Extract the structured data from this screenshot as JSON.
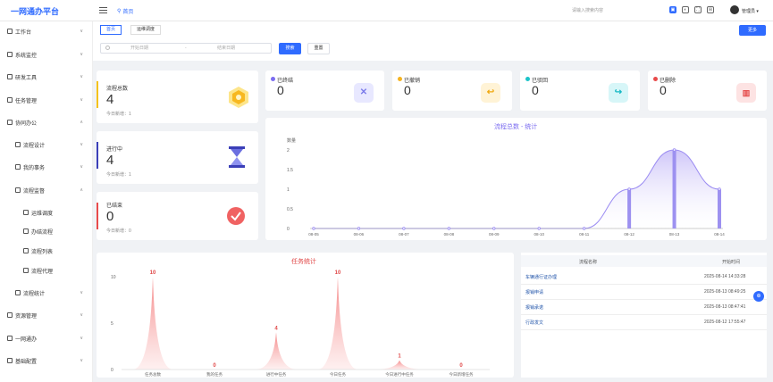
{
  "header": {
    "logo": "一网通办平台",
    "home_tab": "首页",
    "search_placeholder": "请输入搜索内容",
    "user": "管理员"
  },
  "sidebar": {
    "items": [
      {
        "label": "工作台",
        "icon": "monitor-icon"
      },
      {
        "label": "系统监控",
        "icon": "monitor-icon"
      },
      {
        "label": "研发工具",
        "icon": "tools-icon"
      },
      {
        "label": "任务管理",
        "icon": "task-icon"
      },
      {
        "label": "协同办公",
        "icon": "cooperate-icon"
      },
      {
        "label": "流程设计",
        "icon": "design-icon"
      },
      {
        "label": "我的事务",
        "icon": "bell-icon"
      },
      {
        "label": "流程监督",
        "icon": "house-icon"
      },
      {
        "label": "运维调度",
        "icon": "dispatch-icon"
      },
      {
        "label": "办结流程",
        "icon": "link-icon"
      },
      {
        "label": "流程列表",
        "icon": "list-icon"
      },
      {
        "label": "流程代理",
        "icon": "proxy-icon"
      },
      {
        "label": "流程统计",
        "icon": "stats-icon"
      },
      {
        "label": "资源管理",
        "icon": "resource-icon"
      },
      {
        "label": "一网通办",
        "icon": "network-icon"
      },
      {
        "label": "基础配置",
        "icon": "config-icon"
      }
    ]
  },
  "tabs": [
    "首页",
    "运维调度"
  ],
  "more_button": "更多",
  "filter": {
    "start_placeholder": "开始日期",
    "separator": "-",
    "end_placeholder": "结束日期",
    "search": "搜索",
    "reset": "重置"
  },
  "big_cards": [
    {
      "title": "流程总数",
      "value": "4",
      "sub": "今日新增：1",
      "color": "#f5c21a"
    },
    {
      "title": "进行中",
      "value": "4",
      "sub": "今日新增：1",
      "color": "#3b3fb8"
    },
    {
      "title": "已结束",
      "value": "0",
      "sub": "今日新增：0",
      "color": "#e84a4a"
    }
  ],
  "small_cards": [
    {
      "title": "已终结",
      "value": "0",
      "dot": "#7b6cf0",
      "icon_bg": "#e8e8ff",
      "icon_color": "#7b7bea",
      "glyph": "✕"
    },
    {
      "title": "已撤销",
      "value": "0",
      "dot": "#f5b320",
      "icon_bg": "#fff3d6",
      "icon_color": "#f0a810",
      "glyph": "↩"
    },
    {
      "title": "已驳回",
      "value": "0",
      "dot": "#1cc3c9",
      "icon_bg": "#d7f6f8",
      "icon_color": "#14b8c4",
      "glyph": "↪"
    },
    {
      "title": "已删除",
      "value": "0",
      "dot": "#e84a4a",
      "icon_bg": "#fde3e3",
      "icon_color": "#e54848",
      "glyph": "🗑"
    }
  ],
  "chart_data": [
    {
      "type": "area",
      "title": "流程总数 - 统计",
      "ylabel": "数量",
      "categories": [
        "08-05",
        "08-06",
        "08-07",
        "08-08",
        "08-09",
        "08-10",
        "08-11",
        "08-12",
        "08-13",
        "08-14"
      ],
      "values": [
        0,
        0,
        0,
        0,
        0,
        0,
        0,
        1,
        2,
        1
      ],
      "ylim": [
        0,
        2
      ],
      "yticks": [
        "0",
        "0.5",
        "1",
        "1.5",
        "2"
      ],
      "color": "#9b8cf2"
    },
    {
      "type": "area",
      "title": "任务统计",
      "categories": [
        "任务总数",
        "我的任务",
        "进行中任务",
        "今日任务",
        "今日进行中任务",
        "今日新增任务"
      ],
      "values": [
        10,
        0,
        4,
        10,
        1,
        0
      ],
      "ylim": [
        0,
        10
      ],
      "yticks": [
        "0",
        "5",
        "10"
      ],
      "color": "#f08a8a"
    }
  ],
  "table": {
    "columns": [
      "流程名称",
      "开始时间"
    ],
    "rows": [
      {
        "name": "车辆通行证办理",
        "time": "2025-08-14 14:33:28"
      },
      {
        "name": "报销申请",
        "time": "2025-08-13 08:49:25"
      },
      {
        "name": "报销承诺",
        "time": "2025-08-13 08:47:41"
      },
      {
        "name": "行政发文",
        "time": "2025-08-12 17:55:47"
      }
    ]
  }
}
